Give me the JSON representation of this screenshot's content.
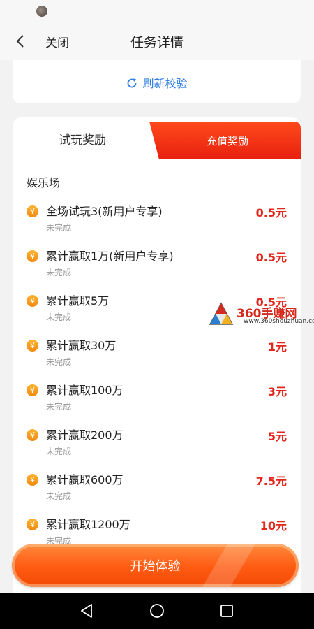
{
  "nav": {
    "close_label": "关闭",
    "title": "任务详情"
  },
  "refresh": {
    "label": "刷新校验"
  },
  "tabs": [
    {
      "label": "试玩奖励",
      "active": true
    },
    {
      "label": "充值奖励",
      "active": false
    }
  ],
  "section": {
    "title": "娱乐场"
  },
  "tasks": [
    {
      "name": "全场试玩3(新用户专享)",
      "status": "未完成",
      "reward": "0.5元"
    },
    {
      "name": "累计赢取1万(新用户专享)",
      "status": "未完成",
      "reward": "0.5元"
    },
    {
      "name": "累计赢取5万",
      "status": "未完成",
      "reward": "0.5元"
    },
    {
      "name": "累计赢取30万",
      "status": "未完成",
      "reward": "1元"
    },
    {
      "name": "累计赢取100万",
      "status": "未完成",
      "reward": "3元"
    },
    {
      "name": "累计赢取200万",
      "status": "未完成",
      "reward": "5元"
    },
    {
      "name": "累计赢取600万",
      "status": "未完成",
      "reward": "7.5元"
    },
    {
      "name": "累计赢取1200万",
      "status": "未完成",
      "reward": "10元"
    }
  ],
  "coin_symbol": "¥",
  "watermark": {
    "text": "360手赚网",
    "url": "www.360shouzhuan.com"
  },
  "start_button": {
    "label": "开始体验"
  },
  "colors": {
    "accent": "#ff5a12",
    "reward": "#e4261c",
    "link": "#2f7fe6"
  }
}
